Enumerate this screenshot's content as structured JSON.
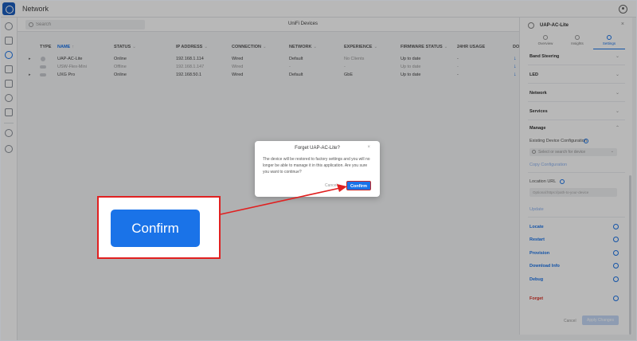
{
  "app": {
    "title": "Network"
  },
  "toolbar": {
    "search_placeholder": "Search",
    "section_title": "UniFi Devices"
  },
  "table": {
    "headers": [
      {
        "label": "TYPE"
      },
      {
        "label": "NAME"
      },
      {
        "label": "STATUS"
      },
      {
        "label": "IP ADDRESS"
      },
      {
        "label": "CONNECTION"
      },
      {
        "label": "NETWORK"
      },
      {
        "label": "EXPERIENCE"
      },
      {
        "label": "FIRMWARE STATUS"
      },
      {
        "label": "24HR USAGE"
      },
      {
        "label": "DO"
      }
    ],
    "rows": [
      {
        "name": "UAP-AC-Lite",
        "status": "Online",
        "ip": "192.168.1.114",
        "connection": "Wired",
        "network": "Default",
        "experience": "No Clients",
        "firmware": "Up to date",
        "usage": "-"
      },
      {
        "name": "USW-Flex-Mini",
        "status": "Offline",
        "ip": "192.168.1.147",
        "connection": "Wired",
        "network": "-",
        "experience": "-",
        "firmware": "Up to date",
        "usage": "-"
      },
      {
        "name": "UXG Pro",
        "status": "Online",
        "ip": "192.168.50.1",
        "connection": "Wired",
        "network": "Default",
        "experience": "GbE",
        "firmware": "Up to date",
        "usage": "-"
      }
    ]
  },
  "panel": {
    "title": "UAP-AC-Lite",
    "tabs": [
      {
        "label": "Overview"
      },
      {
        "label": "Insights"
      },
      {
        "label": "Settings"
      }
    ],
    "sections": [
      "Band Steering",
      "LED",
      "Network",
      "Services",
      "Manage"
    ],
    "existing_config_label": "Existing Device Configuration",
    "select_placeholder": "Select or search for device",
    "copy_config": "Copy Configuration",
    "location_label": "Location URL",
    "location_placeholder": "Optional:https://path-to-your-device",
    "update_link": "Update",
    "actions": [
      "Locate",
      "Restart",
      "Provision",
      "Download Info",
      "Debug"
    ],
    "forget": "Forget",
    "cancel": "Cancel",
    "apply": "Apply Changes"
  },
  "modal": {
    "title": "Forget UAP-AC-Lite?",
    "text": "The device will be restored to factory settings and you will no longer be able to manage it in this application. Are you sure you want to continue?",
    "cancel": "Cancel",
    "confirm": "Confirm"
  },
  "callout": {
    "label": "Confirm"
  },
  "colors": {
    "accent": "#1a73e8",
    "annotation": "#e02020",
    "danger": "#d93025"
  }
}
